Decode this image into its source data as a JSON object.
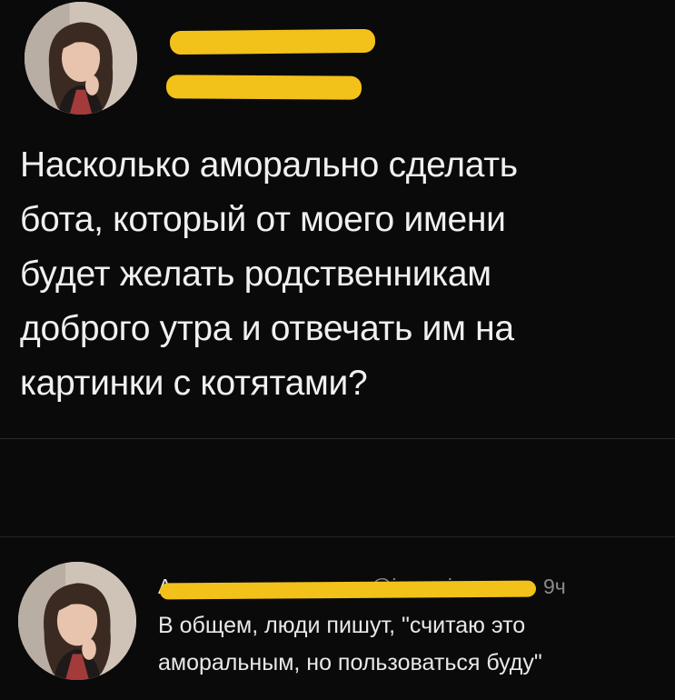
{
  "post": {
    "text": "Насколько аморально сделать\nбота, который от моего имени\nбудет желать родственникам\nдоброго утра и отвечать им на\nкартинки с котятами?"
  },
  "reply": {
    "name_partial": "А",
    "handle_partial": "@iconmi",
    "time": "9ч",
    "text": "В общем, люди пишут, \"считаю это\nаморальным, но пользоваться буду\""
  },
  "colors": {
    "background": "#0a0a0a",
    "text": "#f0f0f0",
    "redaction": "#f2c21a",
    "muted": "#8a8a8a"
  }
}
